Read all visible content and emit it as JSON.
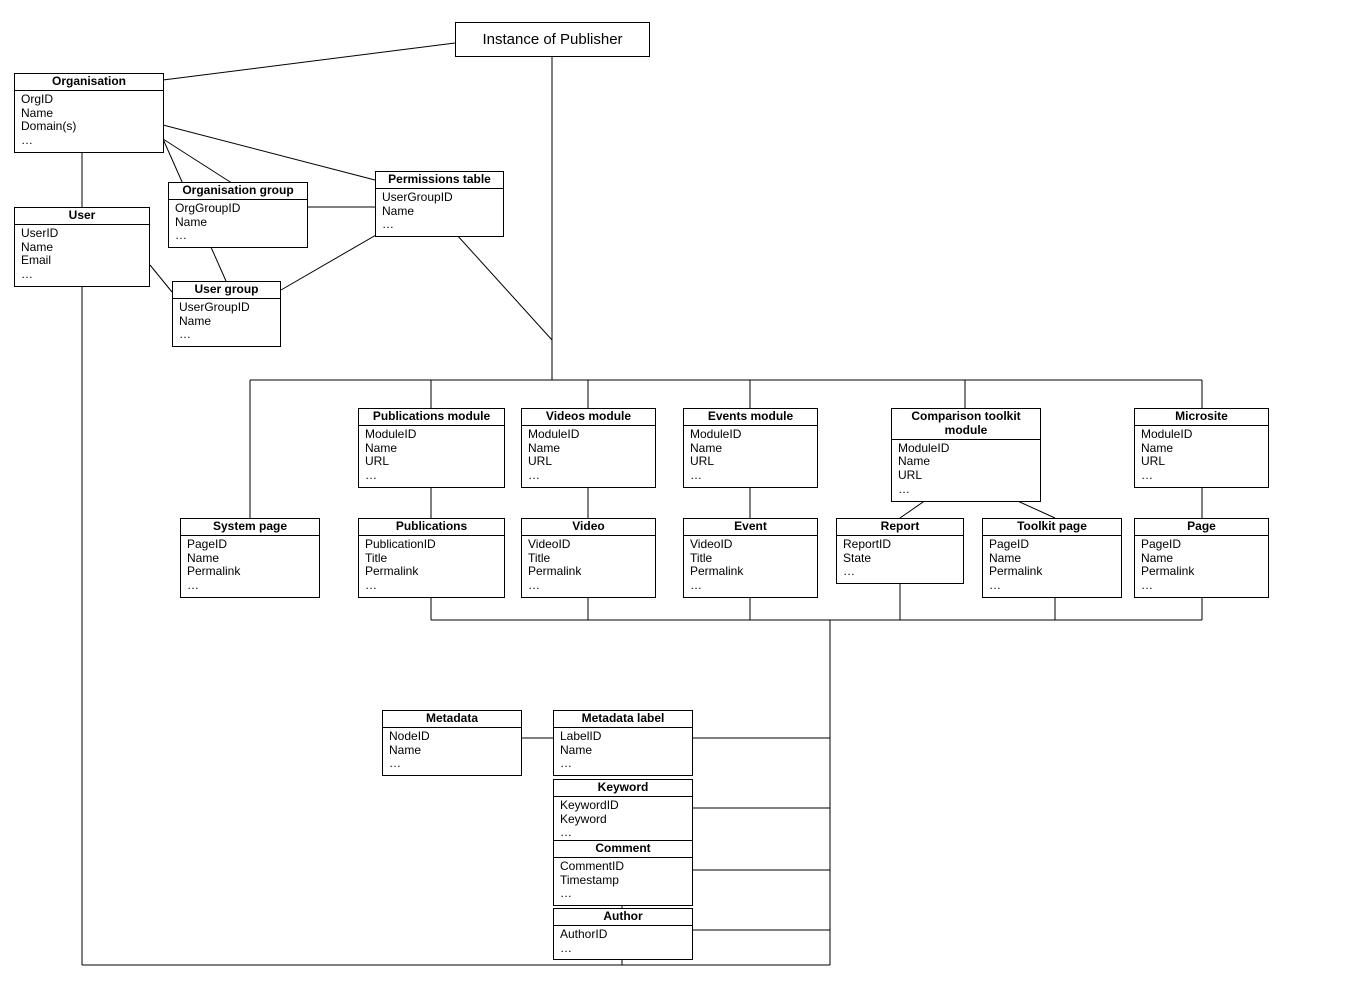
{
  "root": {
    "label": "Instance of Publisher"
  },
  "entities": {
    "organisation": {
      "title": "Organisation",
      "attrs": [
        "OrgID",
        "Name",
        "Domain(s)",
        "…"
      ]
    },
    "user": {
      "title": "User",
      "attrs": [
        "UserID",
        "Name",
        "Email",
        "…"
      ]
    },
    "org_group": {
      "title": "Organisation group",
      "attrs": [
        "OrgGroupID",
        "Name",
        "…"
      ]
    },
    "user_group": {
      "title": "User group",
      "attrs": [
        "UserGroupID",
        "Name",
        "…"
      ]
    },
    "permissions": {
      "title": "Permissions table",
      "attrs": [
        "UserGroupID",
        "Name",
        "…"
      ]
    },
    "pub_module": {
      "title": "Publications module",
      "attrs": [
        "ModuleID",
        "Name",
        "URL",
        "…"
      ]
    },
    "videos_module": {
      "title": "Videos module",
      "attrs": [
        "ModuleID",
        "Name",
        "URL",
        "…"
      ]
    },
    "events_module": {
      "title": "Events module",
      "attrs": [
        "ModuleID",
        "Name",
        "URL",
        "…"
      ]
    },
    "ct_module": {
      "title": "Comparison toolkit module",
      "attrs": [
        "ModuleID",
        "Name",
        "URL",
        "…"
      ]
    },
    "microsite": {
      "title": "Microsite",
      "attrs": [
        "ModuleID",
        "Name",
        "URL",
        "…"
      ]
    },
    "system_page": {
      "title": "System page",
      "attrs": [
        "PageID",
        "Name",
        "Permalink",
        "…"
      ]
    },
    "publications": {
      "title": "Publications",
      "attrs": [
        "PublicationID",
        "Title",
        "Permalink",
        "…"
      ]
    },
    "video": {
      "title": "Video",
      "attrs": [
        "VideoID",
        "Title",
        "Permalink",
        "…"
      ]
    },
    "event": {
      "title": "Event",
      "attrs": [
        "VideoID",
        "Title",
        "Permalink",
        "…"
      ]
    },
    "report": {
      "title": "Report",
      "attrs": [
        "ReportID",
        "State",
        "…"
      ]
    },
    "toolkit_page": {
      "title": "Toolkit page",
      "attrs": [
        "PageID",
        "Name",
        "Permalink",
        "…"
      ]
    },
    "page": {
      "title": "Page",
      "attrs": [
        "PageID",
        "Name",
        "Permalink",
        "…"
      ]
    },
    "metadata": {
      "title": "Metadata",
      "attrs": [
        "NodeID",
        "Name",
        "…"
      ]
    },
    "metadata_label": {
      "title": "Metadata label",
      "attrs": [
        "LabelID",
        "Name",
        "…"
      ]
    },
    "keyword": {
      "title": "Keyword",
      "attrs": [
        "KeywordID",
        "Keyword",
        "…"
      ]
    },
    "comment": {
      "title": "Comment",
      "attrs": [
        "CommentID",
        "Timestamp",
        "…"
      ]
    },
    "author": {
      "title": "Author",
      "attrs": [
        "AuthorID",
        "…"
      ]
    }
  }
}
